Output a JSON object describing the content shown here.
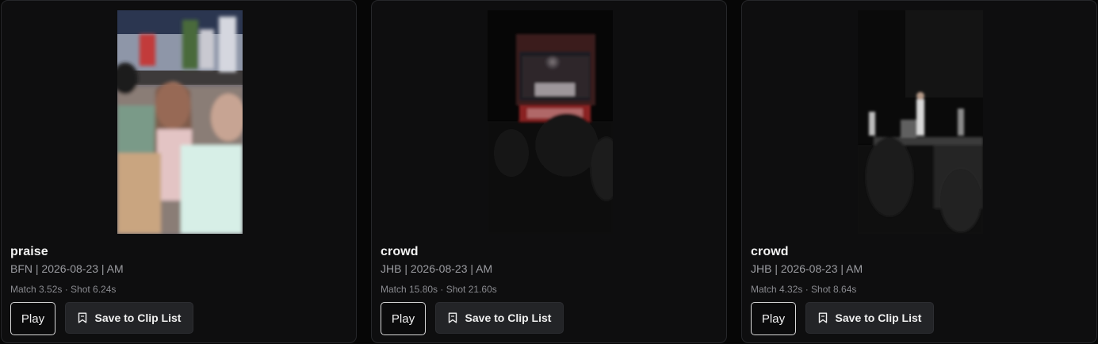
{
  "clips": [
    {
      "tag": "praise",
      "meta": "BFN | 2026-08-23 | AM",
      "stats": "Match 3.52s · Shot 6.24s",
      "play_label": "Play",
      "save_label": "Save to Clip List"
    },
    {
      "tag": "crowd",
      "meta": "JHB | 2026-08-23 | AM",
      "stats": "Match 15.80s · Shot 21.60s",
      "play_label": "Play",
      "save_label": "Save to Clip List"
    },
    {
      "tag": "crowd",
      "meta": "JHB | 2026-08-23 | AM",
      "stats": "Match 4.32s · Shot 8.64s",
      "play_label": "Play",
      "save_label": "Save to Clip List"
    }
  ],
  "icons": {
    "save": "bookmark-icon"
  },
  "colors": {
    "background": "#060606",
    "card": "#0e0e0f",
    "card_border": "#26272a",
    "save_button": "#232427",
    "play_border": "#d9d9d9"
  }
}
